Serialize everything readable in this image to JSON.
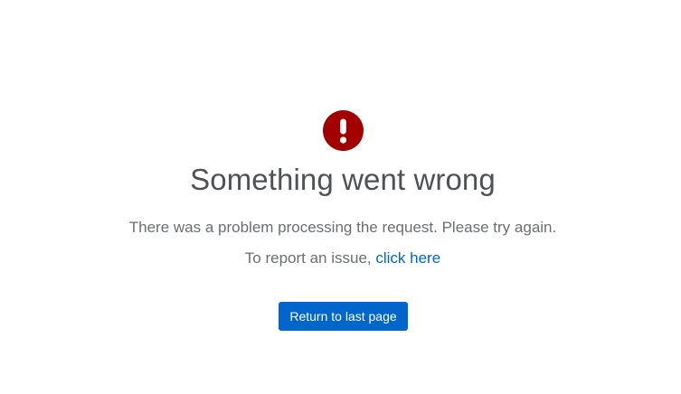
{
  "error": {
    "icon": "exclamation-circle-icon",
    "icon_color": "#a30000",
    "title": "Something went wrong",
    "message": "There was a problem processing the request. Please try again.",
    "report_prefix": "To report an issue, ",
    "report_link": "click here",
    "return_button": "Return to last page"
  },
  "colors": {
    "accent": "#0066cc",
    "title": "#4f5255",
    "body_text": "#6a6e73",
    "background": "#ffffff"
  }
}
